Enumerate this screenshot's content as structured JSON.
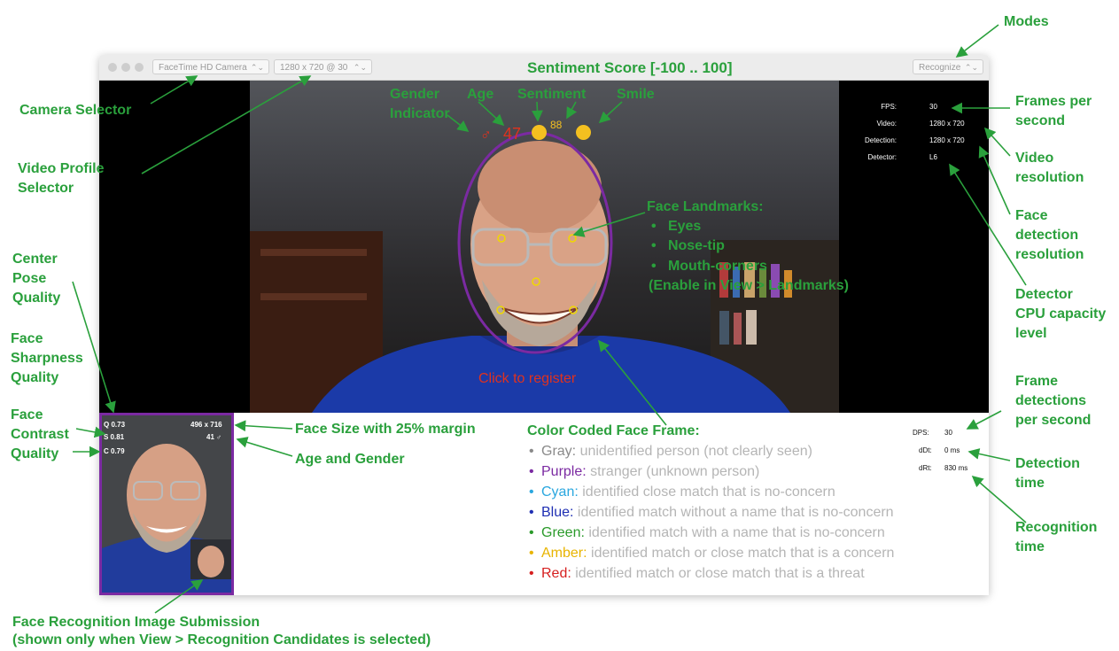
{
  "window": {
    "camera_select": "FaceTime HD Camera",
    "profile_select": "1280 x 720 @ 30",
    "mode_select": "Recognize",
    "title_score_label": "Sentiment Score [-100 .. 100]"
  },
  "overlay": {
    "gender_symbol": "♂",
    "age": "47",
    "sentiment_value": "88",
    "register_text": "Click to register"
  },
  "stats_top": [
    {
      "label": "FPS:",
      "value": "30"
    },
    {
      "label": "Video:",
      "value": "1280 x 720"
    },
    {
      "label": "Detection:",
      "value": "1280 x 720"
    },
    {
      "label": "Detector:",
      "value": "L6"
    }
  ],
  "stats_bottom": [
    {
      "label": "DPS:",
      "value": "30"
    },
    {
      "label": "dDt:",
      "value": "0 ms"
    },
    {
      "label": "dRt:",
      "value": "830 ms"
    }
  ],
  "thumb": {
    "q": "Q 0.73",
    "s": "S 0.81",
    "c": "C 0.79",
    "size": "496 x 716",
    "age_gender": "41 ♂"
  },
  "legend": {
    "title": "Color Coded Face Frame:",
    "items": [
      {
        "color_name": "Gray:",
        "rest": "unidentified person (not clearly seen)",
        "color": "#8a8a8a"
      },
      {
        "color_name": "Purple:",
        "rest": "stranger (unknown person)",
        "color": "#7b2aa2"
      },
      {
        "color_name": "Cyan:",
        "rest": "identified close match that is no-concern",
        "color": "#2aa7df"
      },
      {
        "color_name": "Blue:",
        "rest": "identified match without a name that is no-concern",
        "color": "#1f2fb3"
      },
      {
        "color_name": "Green:",
        "rest": "identified match with a name that is no-concern",
        "color": "#2a9a2a"
      },
      {
        "color_name": "Amber:",
        "rest": "identified match or close match that is a concern",
        "color": "#e8b400"
      },
      {
        "color_name": "Red:",
        "rest": "identified match or close match that is a threat",
        "color": "#d61f1f"
      }
    ]
  },
  "annotations": {
    "modes": "Modes",
    "camera_selector": "Camera Selector",
    "video_profile": "Video Profile\nSelector",
    "gender_indicator": "Gender\nIndicator",
    "age": "Age",
    "sentiment": "Sentiment",
    "smile": "Smile",
    "fps": "Frames per\nsecond",
    "video_res": "Video\nresolution",
    "face_det_res": "Face\ndetection\nresolution",
    "detector_cpu": "Detector\nCPU capacity\nlevel",
    "landmarks_title": "Face Landmarks:",
    "landmarks_eyes": "Eyes",
    "landmarks_nose": "Nose-tip",
    "landmarks_mouth": "Mouth-corners",
    "landmarks_enable": "(Enable in View > Landmarks)",
    "center_pose": "Center\nPose\nQuality",
    "sharpness": "Face\nSharpness\nQuality",
    "contrast": "Face\nContrast\nQuality",
    "face_size": "Face Size with 25% margin",
    "age_gender": "Age and Gender",
    "frame_det": "Frame\ndetections\nper second",
    "det_time": "Detection\ntime",
    "rec_time": "Recognition\ntime",
    "submission_1": "Face Recognition Image Submission",
    "submission_2": "(shown only when View > Recognition Candidates is selected)"
  },
  "colors": {
    "annotation_green": "#2aa03c",
    "face_frame_purple": "#7b2aa2",
    "overlay_red": "#e0321e",
    "emoji_yellow": "#f4c020"
  }
}
